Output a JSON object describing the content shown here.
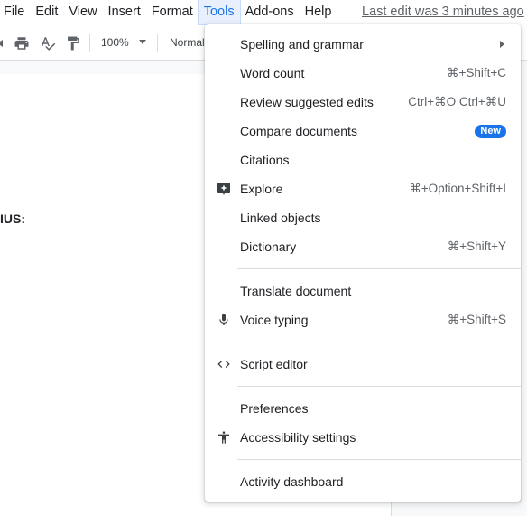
{
  "menubar": {
    "items": [
      "File",
      "Edit",
      "View",
      "Insert",
      "Format",
      "Tools",
      "Add-ons",
      "Help"
    ],
    "active": "Tools",
    "last_edit": "Last edit was 3 minutes ago"
  },
  "toolbar": {
    "zoom": "100%",
    "style": "Normal"
  },
  "document": {
    "visible_text": "IUS:"
  },
  "tools_menu": {
    "items": [
      {
        "label": "Spelling and grammar",
        "submenu": true
      },
      {
        "label": "Word count",
        "shortcut": "⌘+Shift+C"
      },
      {
        "label": "Review suggested edits",
        "shortcut": "Ctrl+⌘O Ctrl+⌘U"
      },
      {
        "label": "Compare documents",
        "badge": "New"
      },
      {
        "label": "Citations"
      },
      {
        "label": "Explore",
        "shortcut": "⌘+Option+Shift+I",
        "icon": "explore-icon"
      },
      {
        "label": "Linked objects"
      },
      {
        "label": "Dictionary",
        "shortcut": "⌘+Shift+Y"
      },
      {
        "label": "Translate document"
      },
      {
        "label": "Voice typing",
        "shortcut": "⌘+Shift+S",
        "icon": "microphone-icon"
      },
      {
        "label": "Script editor",
        "icon": "code-icon"
      },
      {
        "label": "Preferences"
      },
      {
        "label": "Accessibility settings",
        "icon": "accessibility-icon"
      },
      {
        "label": "Activity dashboard"
      }
    ]
  },
  "colors": {
    "accent": "#1a73e8",
    "active_menu_bg": "#e8f0fe",
    "text": "#202124",
    "secondary_text": "#5f6368",
    "divider": "#dadce0"
  }
}
